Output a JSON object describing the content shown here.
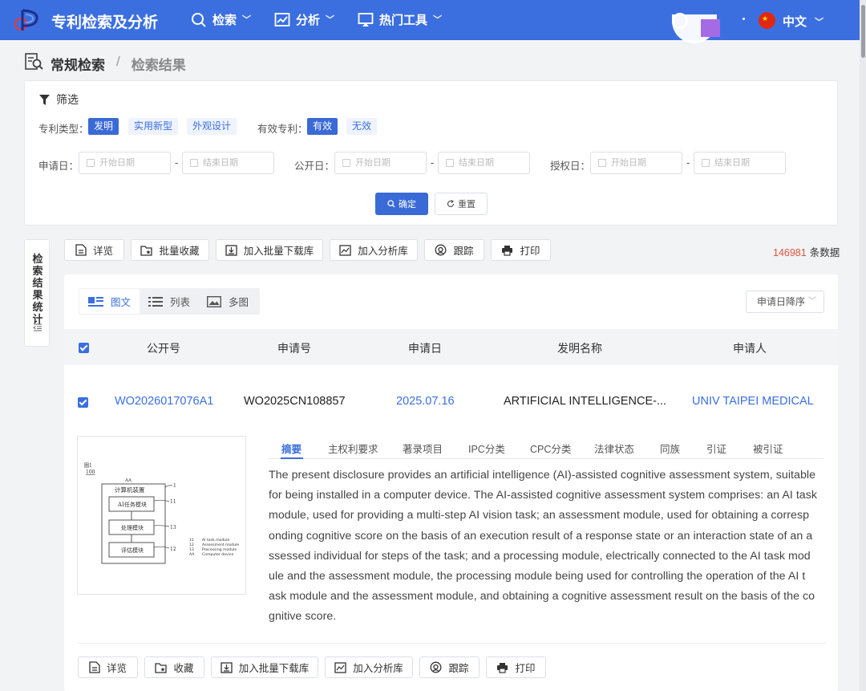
{
  "header": {
    "app_title": "专利检索及分析",
    "nav": [
      {
        "label": "检索",
        "icon": "search-icon"
      },
      {
        "label": "分析",
        "icon": "chart-icon"
      },
      {
        "label": "热门工具",
        "icon": "monitor-icon"
      }
    ],
    "language": "中文"
  },
  "breadcrumb": {
    "root": "常规检索",
    "separator": "/",
    "current": "检索结果"
  },
  "filter": {
    "title": "筛选",
    "patent_type_label": "专利类型：",
    "patent_types": [
      "发明",
      "实用新型",
      "外观设计"
    ],
    "valid_label": "有效专利：",
    "valid_options": [
      "有效",
      "无效"
    ],
    "apply_date_label": "申请日：",
    "publish_date_label": "公开日：",
    "grant_date_label": "授权日：",
    "start_placeholder": "开始日期",
    "end_placeholder": "结束日期",
    "dash": "-",
    "confirm": "确定",
    "reset": "重置"
  },
  "side_tab": {
    "label": "检索结果统计"
  },
  "toolbar": [
    "详览",
    "批量收藏",
    "加入批量下载库",
    "加入分析库",
    "跟踪",
    "打印"
  ],
  "result_count": {
    "number": "146981",
    "suffix": "条数据"
  },
  "view_tabs": [
    "图文",
    "列表",
    "多图"
  ],
  "sort": {
    "label": "申请日降序"
  },
  "table": {
    "headers": [
      "公开号",
      "申请号",
      "申请日",
      "发明名称",
      "申请人"
    ],
    "row": {
      "pub_no": "WO2026017076A1",
      "app_no": "WO2025CN108857",
      "app_date": "2025.07.16",
      "title": "ARTIFICIAL INTELLIGENCE-...",
      "applicant": "UNIV TAIPEI MEDICAL"
    }
  },
  "detail_tabs": [
    "摘要",
    "主权利要求",
    "著录项目",
    "IPC分类",
    "CPC分类",
    "法律状态",
    "同族",
    "引证",
    "被引证"
  ],
  "abstract_lines": [
    "The present disclosure provides an artificial intelligence (AI)-assisted cognitive assessment system, suitable",
    "for being installed in a computer device. The AI-assisted cognitive assessment system comprises: an AI task",
    "module, used for providing a multi-step AI vision task; an assessment module, used for obtaining a corresp",
    "onding cognitive score on the basis of an execution result of a response state or an interaction state of an a",
    "ssessed individual for steps of the task; and a processing module, electrically connected to the AI task mod",
    "ule and the assessment module, the processing module being used for controlling the operation of the AI t",
    "ask module and the assessment module, and obtaining a cognitive assessment result on the basis of the co",
    "gnitive score."
  ],
  "figure": {
    "ref_top": "圖1",
    "ref_num": "100",
    "aa": "AA",
    "device": "计算机装置",
    "modules": [
      "AI任务模块",
      "处理模块",
      "评估模块"
    ],
    "callouts": [
      "1",
      "11",
      "13",
      "12"
    ],
    "legend": [
      {
        "num": "11",
        "text": "AI task module"
      },
      {
        "num": "12",
        "text": "Assessment module"
      },
      {
        "num": "13",
        "text": "Processing module"
      },
      {
        "num": "AA",
        "text": "Computer device"
      }
    ]
  },
  "item_actions": [
    "详览",
    "收藏",
    "加入批量下载库",
    "加入分析库",
    "跟踪",
    "打印"
  ]
}
